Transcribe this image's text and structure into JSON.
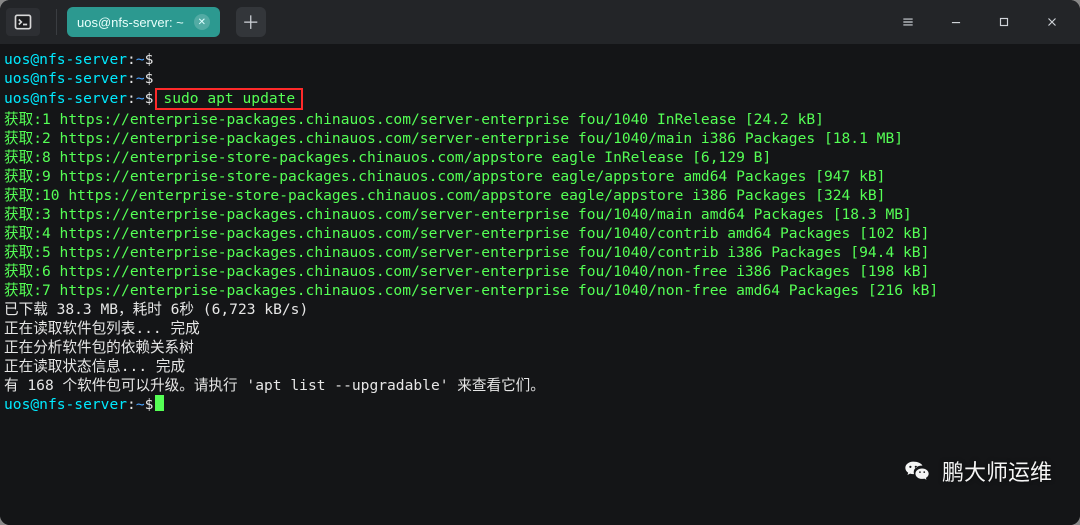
{
  "tab": {
    "title": "uos@nfs-server: ~"
  },
  "prompt": {
    "user": "uos",
    "host": "nfs-server",
    "path": "~",
    "sep_uh": "@",
    "sep_hp": ":",
    "dollar": "$"
  },
  "cmd": {
    "highlighted": "sudo apt update"
  },
  "lines": [
    "获取:1 https://enterprise-packages.chinauos.com/server-enterprise fou/1040 InRelease [24.2 kB]",
    "获取:2 https://enterprise-packages.chinauos.com/server-enterprise fou/1040/main i386 Packages [18.1 MB]",
    "获取:8 https://enterprise-store-packages.chinauos.com/appstore eagle InRelease [6,129 B]",
    "获取:9 https://enterprise-store-packages.chinauos.com/appstore eagle/appstore amd64 Packages [947 kB]",
    "获取:10 https://enterprise-store-packages.chinauos.com/appstore eagle/appstore i386 Packages [324 kB]",
    "获取:3 https://enterprise-packages.chinauos.com/server-enterprise fou/1040/main amd64 Packages [18.3 MB]",
    "获取:4 https://enterprise-packages.chinauos.com/server-enterprise fou/1040/contrib amd64 Packages [102 kB]",
    "获取:5 https://enterprise-packages.chinauos.com/server-enterprise fou/1040/contrib i386 Packages [94.4 kB]",
    "获取:6 https://enterprise-packages.chinauos.com/server-enterprise fou/1040/non-free i386 Packages [198 kB]",
    "获取:7 https://enterprise-packages.chinauos.com/server-enterprise fou/1040/non-free amd64 Packages [216 kB]",
    "已下载 38.3 MB，耗时 6秒 (6,723 kB/s)",
    "正在读取软件包列表... 完成",
    "正在分析软件包的依赖关系树",
    "正在读取状态信息... 完成",
    "有 168 个软件包可以升级。请执行 'apt list --upgradable' 来查看它们。"
  ],
  "watermark": {
    "text": "鹏大师运维"
  }
}
